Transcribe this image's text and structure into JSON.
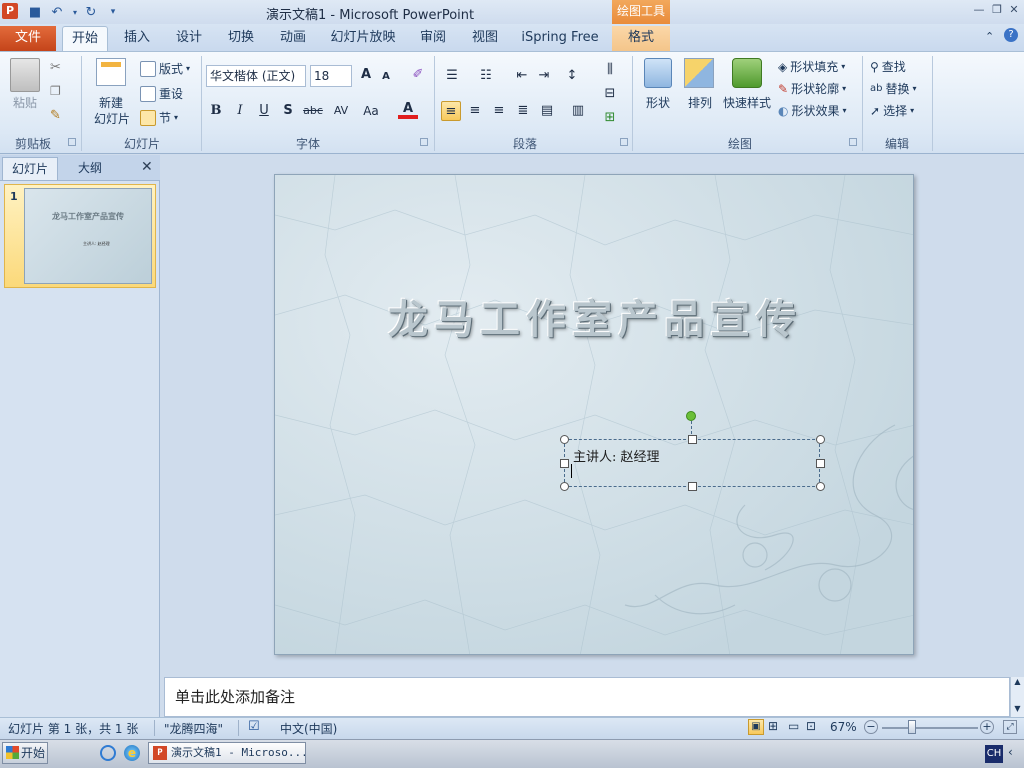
{
  "window": {
    "app_icon_letter": "P",
    "title": "演示文稿1 - Microsoft PowerPoint",
    "context_group": "绘图工具",
    "min": "—",
    "restore": "❐",
    "close": "✕"
  },
  "tabs": {
    "file": "文件",
    "home": "开始",
    "insert": "插入",
    "design": "设计",
    "transitions": "切换",
    "animations": "动画",
    "slideshow": "幻灯片放映",
    "review": "审阅",
    "view": "视图",
    "ispring": "iSpring Free",
    "format": "格式"
  },
  "ribbon": {
    "clipboard": {
      "paste": "粘贴",
      "label": "剪贴板"
    },
    "slides": {
      "new_slide_1": "新建",
      "new_slide_2": "幻灯片",
      "layout": "版式",
      "reset": "重设",
      "section": "节",
      "label": "幻灯片"
    },
    "font": {
      "name": "华文楷体 (正文)",
      "size": "18",
      "label": "字体",
      "bold": "B",
      "italic": "I",
      "underline": "U",
      "shadow": "S",
      "strike": "abc",
      "spacing": "AV",
      "case": "Aa",
      "color": "A",
      "grow": "A",
      "shrink": "A"
    },
    "paragraph": {
      "label": "段落"
    },
    "drawing": {
      "shapes": "形状",
      "arrange": "排列",
      "quick_styles": "快速样式",
      "fill": "形状填充",
      "outline": "形状轮廓",
      "effects": "形状效果",
      "label": "绘图"
    },
    "editing": {
      "find": "查找",
      "replace": "替换",
      "select": "选择",
      "label": "编辑"
    }
  },
  "panel": {
    "tab_slides": "幻灯片",
    "tab_outline": "大纲",
    "slide_number": "1",
    "thumb_title": "龙马工作室产品宣传",
    "thumb_subtitle": "主讲人: 赵经理"
  },
  "slide": {
    "title": "龙马工作室产品宣传",
    "subtitle": "主讲人: 赵经理"
  },
  "notes": {
    "placeholder": "单击此处添加备注"
  },
  "status": {
    "slide_info": "幻灯片 第 1 张，共 1 张",
    "theme": "\"龙腾四海\"",
    "language": "中文(中国)",
    "zoom": "67%"
  },
  "taskbar": {
    "start": "开始",
    "item": "演示文稿1 - Microso...",
    "ime": "CH"
  }
}
